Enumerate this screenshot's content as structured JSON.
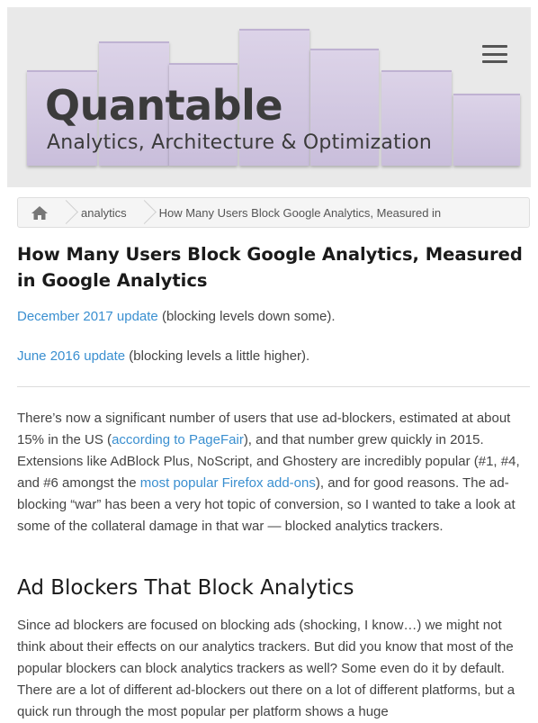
{
  "header": {
    "title": "Quantable",
    "subtitle": "Analytics, Architecture & Optimization",
    "menu_icon": "hamburger-menu-icon",
    "colors": {
      "bar": "#d3c8e2",
      "background": "#e9e9e9",
      "logo_text": "#3b3b3b"
    }
  },
  "breadcrumb": {
    "home_icon": "home-icon",
    "items": [
      "analytics",
      "How Many Users Block Google Analytics, Measured in"
    ]
  },
  "article": {
    "title": "How Many Users Block Google Analytics, Measured in Google Analytics",
    "updates": [
      {
        "link": "December 2017 update",
        "text": " (blocking levels down some)."
      },
      {
        "link": "June 2016 update",
        "text": " (blocking levels a little higher)."
      }
    ],
    "intro": {
      "p1": "There’s now a significant number of users that use ad-blockers, estimated at about 15% in the US (",
      "link1": "according to PageFair",
      "p2": "), and that number grew quickly in 2015. Extensions like AdBlock Plus, NoScript, and Ghostery are incredibly popular (#1, #4, and #6 amongst the ",
      "link2": "most popular Firefox add-ons",
      "p3": "), and for good reasons.  The ad-blocking “war” has been a very hot topic of conversion, so I wanted to take a look at some of the collateral damage in that war — blocked analytics trackers."
    },
    "section_heading": "Ad Blockers That Block Analytics",
    "section_para": "Since ad blockers are focused on blocking ads (shocking, I know…) we might not think about their effects on our analytics trackers. But did you know that most of the popular blockers can block analytics trackers as well? Some even do it by default. There are a lot of different ad-blockers out there on a lot of different platforms, but a quick run through the most popular per platform shows a huge"
  },
  "colors": {
    "link": "#3a8fd0",
    "text": "#444444",
    "heading": "#1a1a1a"
  }
}
